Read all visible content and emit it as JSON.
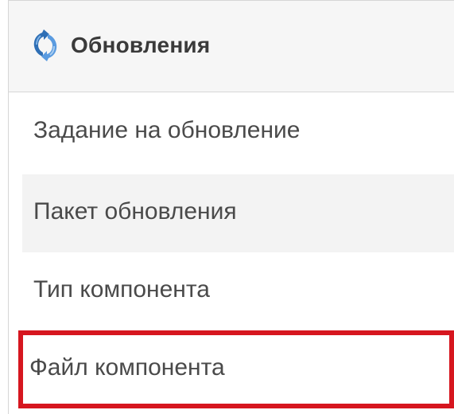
{
  "panel": {
    "title": "Обновления",
    "icon": "refresh-icon"
  },
  "menu": {
    "items": [
      {
        "label": "Задание на обновление",
        "selected": false
      },
      {
        "label": "Пакет обновления",
        "selected": false
      },
      {
        "label": "Тип компонента",
        "selected": false
      },
      {
        "label": "Файл компонента",
        "selected": true
      }
    ]
  },
  "colors": {
    "header_bg": "#f6f6f6",
    "alt_row_bg": "#f3f3f3",
    "highlight_border": "#d6161f",
    "icon_blue_dark": "#2f6fb5",
    "icon_blue_light": "#7fb2e5",
    "text": "#4a4a4a"
  }
}
